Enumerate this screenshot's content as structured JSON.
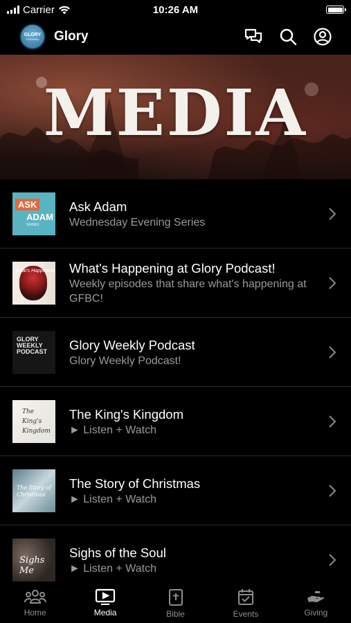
{
  "status_bar": {
    "carrier": "Carrier",
    "time": "10:26 AM"
  },
  "header": {
    "logo_text": "GLORY",
    "logo_sub": "Fellowship",
    "title": "Glory",
    "icons": [
      "chat-icon",
      "search-icon",
      "profile-icon"
    ]
  },
  "hero": {
    "title": "MEDIA"
  },
  "items": [
    {
      "title": "Ask Adam",
      "subtitle": "Wednesday Evening Series",
      "thumb": {
        "line1": "ASK",
        "line2": "ADAM",
        "line3": "SERIES"
      }
    },
    {
      "title": "What's Happening at Glory Podcast!",
      "subtitle": "Weekly episodes that share what's happening at GFBC!",
      "thumb": {
        "line1": "What's Happening"
      }
    },
    {
      "title": "Glory Weekly Podcast",
      "subtitle": "Glory Weekly Podcast!",
      "thumb": {
        "line1": "GLORY",
        "line2": "WEEKLY",
        "line3": "PODCAST"
      }
    },
    {
      "title": "The King's Kingdom",
      "subtitle": "► Listen + Watch",
      "thumb": {
        "line1": "The",
        "line2": "King's",
        "line3": "Kingdom"
      }
    },
    {
      "title": "The Story of Christmas",
      "subtitle": "► Listen + Watch",
      "thumb": {
        "line1": "The Story of",
        "line2": "Christmas"
      }
    },
    {
      "title": "Sighs of the Soul",
      "subtitle": "► Listen + Watch",
      "thumb": {
        "line1": "Sighs Me"
      }
    }
  ],
  "tabs": [
    {
      "label": "Home",
      "icon": "people-icon",
      "active": false
    },
    {
      "label": "Media",
      "icon": "tv-play-icon",
      "active": true
    },
    {
      "label": "Bible",
      "icon": "bible-icon",
      "active": false
    },
    {
      "label": "Events",
      "icon": "calendar-icon",
      "active": false
    },
    {
      "label": "Giving",
      "icon": "giving-hand-icon",
      "active": false
    }
  ],
  "colors": {
    "background": "#000000",
    "subtitle": "#9a9a9a",
    "tab_inactive": "#8e8e8e",
    "tab_active": "#ffffff"
  }
}
